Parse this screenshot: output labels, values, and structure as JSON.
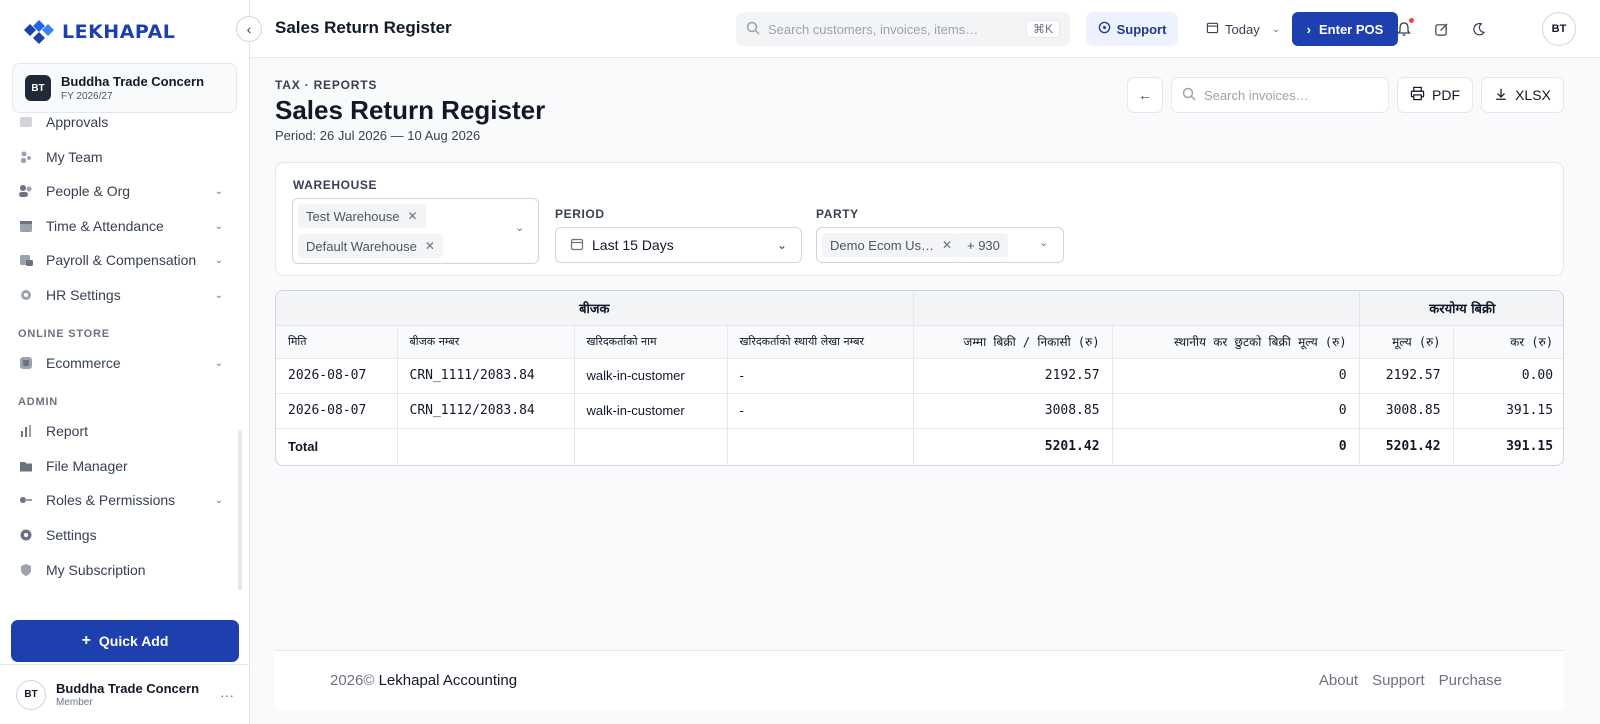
{
  "app": {
    "logo_text": "LEKHAPAL",
    "brand_color": "#1e40af"
  },
  "org": {
    "initials": "BT",
    "name": "Buddha Trade Concern",
    "fiscal_year": "FY 2026/27"
  },
  "sidebar": {
    "items": [
      {
        "label": "Approvals",
        "icon": "approval-icon"
      },
      {
        "label": "My Team",
        "icon": "team-icon"
      },
      {
        "label": "People & Org",
        "icon": "people-icon",
        "expandable": true
      },
      {
        "label": "Time & Attendance",
        "icon": "calendar-icon",
        "expandable": true
      },
      {
        "label": "Payroll & Compensation",
        "icon": "payroll-icon",
        "expandable": true
      },
      {
        "label": "HR Settings",
        "icon": "gear-icon",
        "expandable": true
      }
    ],
    "section_online_store": "ONLINE STORE",
    "online_store_items": [
      {
        "label": "Ecommerce",
        "icon": "store-icon",
        "expandable": true
      }
    ],
    "section_admin": "ADMIN",
    "admin_items": [
      {
        "label": "Report",
        "icon": "chart-icon"
      },
      {
        "label": "File Manager",
        "icon": "folder-icon"
      },
      {
        "label": "Roles & Permissions",
        "icon": "key-icon",
        "expandable": true
      },
      {
        "label": "Settings",
        "icon": "gear-icon"
      },
      {
        "label": "My Subscription",
        "icon": "shield-icon"
      }
    ],
    "quick_add_label": "Quick Add"
  },
  "user": {
    "initials": "BT",
    "name": "Buddha Trade Concern",
    "role": "Member"
  },
  "topbar": {
    "title": "Sales Return Register",
    "search_placeholder": "Search customers, invoices, items…",
    "search_shortcut": "⌘K",
    "support_label": "Support",
    "today_label": "Today",
    "enter_pos_label": "Enter POS",
    "avatar_initials": "BT"
  },
  "page": {
    "breadcrumb": "TAX · REPORTS",
    "title": "Sales Return Register",
    "period_text": "Period: 26 Jul 2026 — 10 Aug 2026",
    "invoice_search_placeholder": "Search invoices…",
    "pdf_label": "PDF",
    "xlsx_label": "XLSX"
  },
  "filters": {
    "warehouse_label": "WAREHOUSE",
    "warehouses": [
      "Test Warehouse",
      "Default Warehouse"
    ],
    "period_label": "PERIOD",
    "period_value": "Last 15 Days",
    "party_label": "PARTY",
    "party_chip": "Demo Ecom Us…",
    "party_more": "+ 930"
  },
  "table": {
    "group_headers": {
      "invoice": "बीजक",
      "taxable": "करयोग्य बिक्री"
    },
    "columns": [
      "मिति",
      "बीजक नम्बर",
      "खरिदकर्ताको नाम",
      "खरिदकर्ताको स्थायी लेखा नम्बर",
      "जम्मा बिक्री / निकासी (रु)",
      "स्थानीय कर छुटको बिक्री मूल्य (रु)",
      "मूल्य (रु)",
      "कर (रु)"
    ],
    "rows": [
      {
        "date": "2026-08-07",
        "invoice_no": "CRN_1111/2083.84",
        "buyer": "walk-in-customer",
        "pan": "-",
        "total": "2192.57",
        "exempt": "0",
        "value": "2192.57",
        "tax": "0.00"
      },
      {
        "date": "2026-08-07",
        "invoice_no": "CRN_1112/2083.84",
        "buyer": "walk-in-customer",
        "pan": "-",
        "total": "3008.85",
        "exempt": "0",
        "value": "3008.85",
        "tax": "391.15"
      }
    ],
    "totals": {
      "label": "Total",
      "total": "5201.42",
      "exempt": "0",
      "value": "5201.42",
      "tax": "391.15"
    }
  },
  "footer": {
    "year": "2026©",
    "company": "Lekhapal Accounting",
    "links": [
      "About",
      "Support",
      "Purchase"
    ]
  }
}
